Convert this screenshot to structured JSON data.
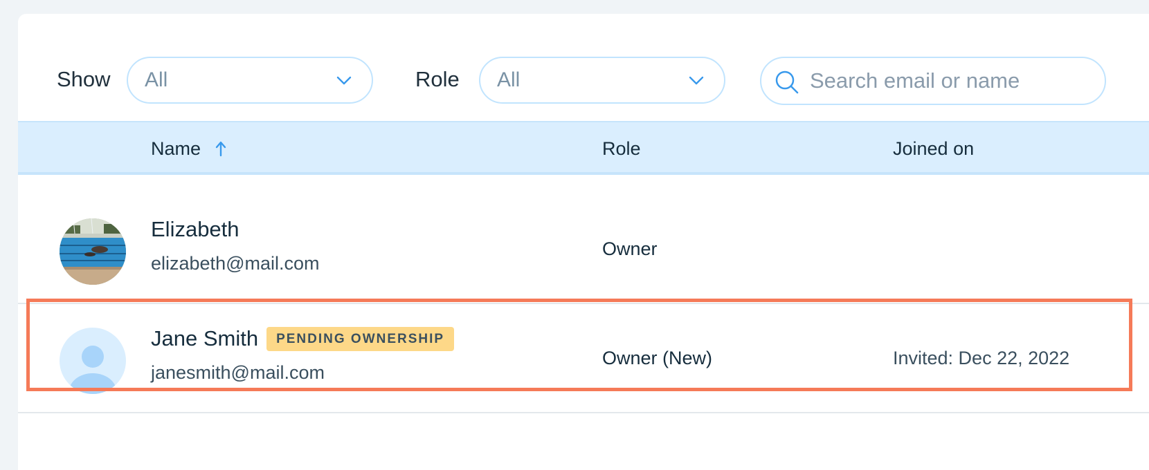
{
  "filters": {
    "show_label": "Show",
    "show_value": "All",
    "role_label": "Role",
    "role_value": "All",
    "search_placeholder": "Search email or name"
  },
  "table": {
    "columns": {
      "name": "Name",
      "role": "Role",
      "joined": "Joined on"
    },
    "sort": {
      "column": "Name",
      "direction": "ascending"
    },
    "rows": [
      {
        "name": "Elizabeth",
        "email": "elizabeth@mail.com",
        "role": "Owner",
        "joined": "",
        "avatar": "photo-avatar"
      },
      {
        "name": "Jane Smith",
        "badge": "PENDING OWNERSHIP",
        "email": "janesmith@mail.com",
        "role": "Owner (New)",
        "joined": "Invited: Dec 22, 2022",
        "avatar": "placeholder-user-avatar",
        "highlighted": true
      }
    ]
  },
  "colors": {
    "accent": "#3899ec",
    "header_bg": "#daeefe",
    "badge_bg": "#fdd888",
    "highlight": "#f57a58",
    "input_border": "#c1e4fe"
  }
}
